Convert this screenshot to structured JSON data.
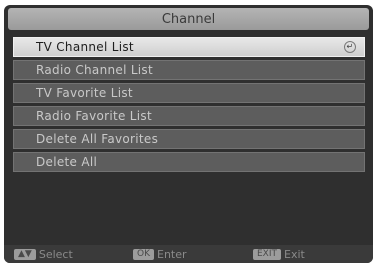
{
  "header": {
    "title": "Channel"
  },
  "menu": {
    "items": [
      {
        "label": "TV Channel List",
        "selected": true
      },
      {
        "label": "Radio Channel List",
        "selected": false
      },
      {
        "label": "TV Favorite List",
        "selected": false
      },
      {
        "label": "Radio Favorite List",
        "selected": false
      },
      {
        "label": "Delete All Favorites",
        "selected": false
      },
      {
        "label": "Delete All",
        "selected": false
      }
    ],
    "enter_icon": "enter-icon"
  },
  "footer": {
    "select": {
      "key": "▲▼",
      "label": "Select"
    },
    "enter": {
      "key": "OK",
      "label": "Enter"
    },
    "exit": {
      "key": "EXIT",
      "label": "Exit"
    }
  }
}
